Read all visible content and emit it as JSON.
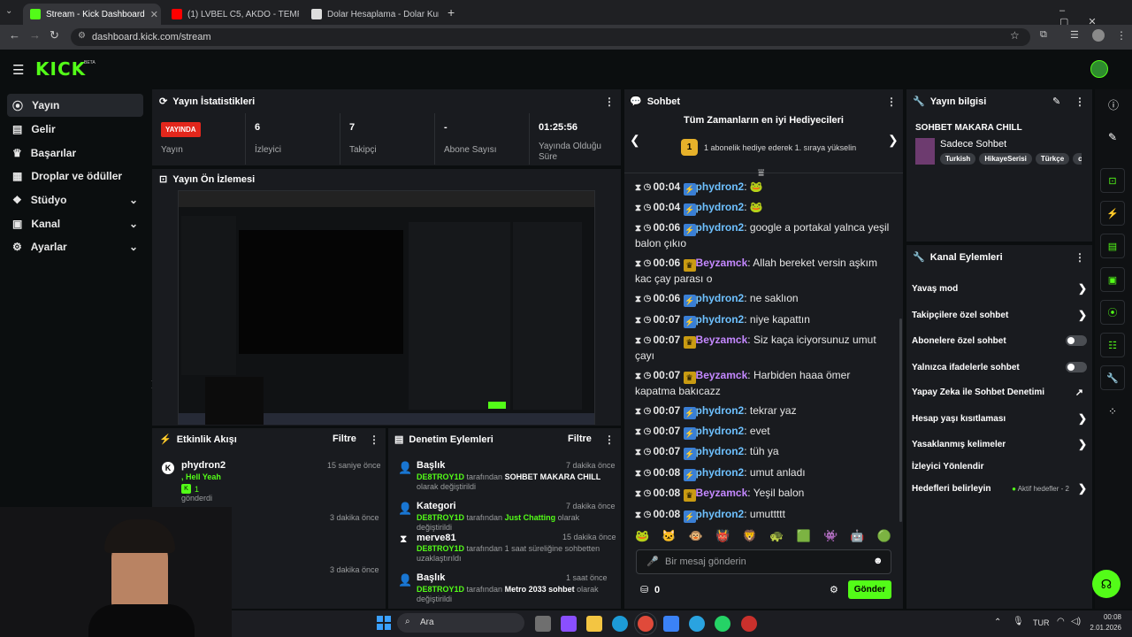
{
  "browser": {
    "tabs": [
      {
        "label": "Stream - Kick Dashboard"
      },
      {
        "label": "(1) LVBEL C5, AKDO - TEMP"
      },
      {
        "label": "Dolar Hesaplama - Dolar Kuru"
      }
    ],
    "url": "dashboard.kick.com/stream"
  },
  "brand": {
    "logo": "KICK",
    "beta": "BETA",
    "accent": "#53fc18"
  },
  "sidebar": {
    "items": [
      {
        "label": "Yayın"
      },
      {
        "label": "Gelir"
      },
      {
        "label": "Başarılar"
      },
      {
        "label": "Droplar ve ödüller"
      },
      {
        "label": "Stüdyo"
      },
      {
        "label": "Kanal"
      },
      {
        "label": "Ayarlar"
      }
    ]
  },
  "stats": {
    "title": "Yayın İstatistikleri",
    "live_badge": "YAYINDA",
    "cells": [
      {
        "label": "Yayın"
      },
      {
        "value": "6",
        "label": "İzleyici"
      },
      {
        "value": "7",
        "label": "Takipçi"
      },
      {
        "value": "-",
        "label": "Abone Sayısı"
      },
      {
        "value": "01:25:56",
        "label": "Yayında Olduğu Süre"
      }
    ]
  },
  "preview": {
    "title": "Yayın Ön İzlemesi"
  },
  "activity": {
    "title": "Etkinlik Akışı",
    "filter": "Filtre",
    "items": [
      {
        "user": "phydron2",
        "msg": ", Hell Yeah",
        "count": "1",
        "sent": "gönderdi",
        "time": "15 saniye önce"
      },
      {
        "time": "3 dakika önce"
      },
      {
        "time": "3 dakika önce"
      }
    ]
  },
  "moderation": {
    "title": "Denetim Eylemleri",
    "filter": "Filtre",
    "items": [
      {
        "title": "Başlık",
        "time": "7 dakika önce",
        "actor": "DE8TROY1D",
        "pre": "tarafından",
        "highlight": "SOHBET MAKARA CHILL",
        "post": "olarak değiştirildi"
      },
      {
        "title": "Kategori",
        "time": "7 dakika önce",
        "actor": "DE8TROY1D",
        "pre": "tarafından",
        "highlight": "Just Chatting",
        "post": "olarak değiştirildi"
      },
      {
        "title": "merve81",
        "time": "15 dakika önce",
        "actor": "DE8TROY1D",
        "pre": "tarafından 1 saat süreliğine sohbetten uzaklaştırıldı",
        "highlight": "",
        "post": ""
      },
      {
        "title": "Başlık",
        "time": "1 saat önce",
        "actor": "DE8TROY1D",
        "pre": "tarafından",
        "highlight": "Metro 2033 sohbet",
        "post": "olarak değiştirildi"
      }
    ]
  },
  "chat": {
    "title": "Sohbet",
    "gifters_title": "Tüm Zamanların en iyi Hediyecileri",
    "gifters_rank": "1",
    "gifters_text": "1 abonelik hediye ederek 1. sıraya yükselin",
    "placeholder": "Bir mesaj gönderin",
    "points": "0",
    "send": "Gönder",
    "messages": [
      {
        "time": "00:04",
        "user": "phydron2",
        "badge": "blue",
        "text": "🐸"
      },
      {
        "time": "00:04",
        "user": "phydron2",
        "badge": "blue",
        "text": "🐸"
      },
      {
        "time": "00:06",
        "user": "phydron2",
        "badge": "blue",
        "text": "google a portakal yalnca yeşil balon çıkıo"
      },
      {
        "time": "00:06",
        "user": "Beyzamck",
        "badge": "gold",
        "text": "Allah bereket versin aşkım kac çay parası o"
      },
      {
        "time": "00:06",
        "user": "phydron2",
        "badge": "blue",
        "text": "ne saklıon"
      },
      {
        "time": "00:07",
        "user": "phydron2",
        "badge": "blue",
        "text": "niye kapattın"
      },
      {
        "time": "00:07",
        "user": "Beyzamck",
        "badge": "gold",
        "text": "Siz kaça iciyorsunuz umut çayı"
      },
      {
        "time": "00:07",
        "user": "Beyzamck",
        "badge": "gold",
        "text": "Harbiden haaa ömer kapatma bakıcazz"
      },
      {
        "time": "00:07",
        "user": "phydron2",
        "badge": "blue",
        "text": "tekrar yaz"
      },
      {
        "time": "00:07",
        "user": "phydron2",
        "badge": "blue",
        "text": "evet"
      },
      {
        "time": "00:07",
        "user": "phydron2",
        "badge": "blue",
        "text": "tüh ya"
      },
      {
        "time": "00:08",
        "user": "phydron2",
        "badge": "blue",
        "text": "umut anladı"
      },
      {
        "time": "00:08",
        "user": "Beyzamck",
        "badge": "gold",
        "text": "Yeşil balon"
      },
      {
        "time": "00:08",
        "user": "phydron2",
        "badge": "blue",
        "text": "umuttttt"
      }
    ]
  },
  "info": {
    "title": "Yayın bilgisi",
    "stream_title": "SOHBET MAKARA CHILL",
    "category": "Sadece Sohbet",
    "tags": [
      "Turkish",
      "HikayeSerisi",
      "Türkçe",
      "c"
    ]
  },
  "actions": {
    "title": "Kanal Eylemleri",
    "items": [
      {
        "label": "Yavaş mod",
        "kind": "chevron"
      },
      {
        "label": "Takipçilere özel sohbet",
        "kind": "chevron"
      },
      {
        "label": "Abonelere özel sohbet",
        "kind": "toggle"
      },
      {
        "label": "Yalnızca ifadelerle sohbet",
        "kind": "toggle"
      },
      {
        "label": "Yapay Zeka ile Sohbet Denetimi",
        "kind": "external"
      },
      {
        "label": "Hesap yaşı kısıtlaması",
        "kind": "chevron"
      },
      {
        "label": "Yasaklanmış kelimeler",
        "kind": "chevron"
      },
      {
        "label": "İzleyici Yönlendir",
        "kind": "none"
      },
      {
        "label": "Hedefleri belirleyin",
        "kind": "chevron",
        "extra": "Aktif hedefler - 2"
      }
    ]
  },
  "taskbar": {
    "search": "Ara",
    "lang": "TUR",
    "time": "00:08",
    "date": "2.01.2026"
  }
}
